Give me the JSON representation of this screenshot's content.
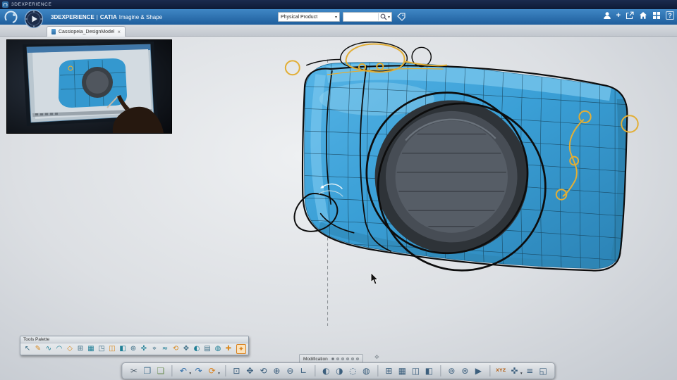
{
  "window_strip": {
    "brand": "3DEXPERIENCE"
  },
  "header": {
    "brand": "3DEXPERIENCE",
    "separator": "|",
    "app": "CATIA",
    "app_name": "Imagine & Shape",
    "context_value": "Physical Product",
    "context_caret": "▾",
    "search_placeholder": "",
    "search_caret": "▾",
    "add_label": "+",
    "help_label": "?",
    "icon_names": [
      "user-icon",
      "add-icon",
      "share-icon",
      "home-icon",
      "app-grid-icon",
      "help-icon",
      "search-icon",
      "tag-icon",
      "compass-icon",
      "3ds-logo"
    ]
  },
  "tab": {
    "label": "Cassiopeia_DesignModel",
    "close": "×"
  },
  "tools_palette": {
    "title": "Tools Palette",
    "icons": [
      {
        "name": "select",
        "glyph": "↖",
        "color": "#3c6e86"
      },
      {
        "name": "sketch-curve",
        "glyph": "✎",
        "color": "#d9891f"
      },
      {
        "name": "curve-wave",
        "glyph": "∿",
        "color": "#1f7f96"
      },
      {
        "name": "arc",
        "glyph": "◠",
        "color": "#1f7f96"
      },
      {
        "name": "face",
        "glyph": "◇",
        "color": "#d9891f"
      },
      {
        "name": "subdivide",
        "glyph": "⊞",
        "color": "#3c6e86"
      },
      {
        "name": "mesh",
        "glyph": "▦",
        "color": "#1f7f96"
      },
      {
        "name": "cut-face",
        "glyph": "◳",
        "color": "#3c6e86"
      },
      {
        "name": "extrude",
        "glyph": "◫",
        "color": "#d9891f"
      },
      {
        "name": "split",
        "glyph": "◧",
        "color": "#1f7f96"
      },
      {
        "name": "weld",
        "glyph": "⊕",
        "color": "#3c6e86"
      },
      {
        "name": "align",
        "glyph": "✜",
        "color": "#1f7f96"
      },
      {
        "name": "target-snap",
        "glyph": "⌖",
        "color": "#3c6e86"
      },
      {
        "name": "smooth",
        "glyph": "≈",
        "color": "#1f7f96"
      },
      {
        "name": "revolve",
        "glyph": "⟲",
        "color": "#d9891f"
      },
      {
        "name": "symmetry",
        "glyph": "✥",
        "color": "#3c6e86"
      },
      {
        "name": "shade-half",
        "glyph": "◐",
        "color": "#1f7f96"
      },
      {
        "name": "panel",
        "glyph": "▤",
        "color": "#3c6e86"
      },
      {
        "name": "sphere-mode",
        "glyph": "◍",
        "color": "#1f7f96"
      },
      {
        "name": "add-point",
        "glyph": "✚",
        "color": "#d9891f"
      },
      {
        "name": "modification-active",
        "glyph": "✦",
        "color": "#d9821f",
        "active": true
      }
    ]
  },
  "status": {
    "label": "Modification",
    "dot_count": 6,
    "active_dot": 0,
    "handle_glyph": "✥"
  },
  "dock": {
    "caret": "▾",
    "groups": [
      {
        "icons": [
          {
            "name": "cut",
            "glyph": "✂",
            "color": "#54626f"
          },
          {
            "name": "copy",
            "glyph": "❐",
            "color": "#44708f"
          },
          {
            "name": "paste",
            "glyph": "❏",
            "color": "#6d8f54"
          }
        ]
      },
      {
        "icons": [
          {
            "name": "undo",
            "glyph": "↶",
            "color": "#2f6da8",
            "caret": true
          },
          {
            "name": "redo",
            "glyph": "↷",
            "color": "#2f6da8"
          },
          {
            "name": "update",
            "glyph": "⟳",
            "color": "#d9821f",
            "caret": true
          }
        ]
      },
      {
        "icons": [
          {
            "name": "fit-all",
            "glyph": "⊡",
            "color": "#3c5f7d"
          },
          {
            "name": "pan",
            "glyph": "✥",
            "color": "#3c5f7d"
          },
          {
            "name": "rotate-view",
            "glyph": "⟲",
            "color": "#3c5f7d"
          },
          {
            "name": "zoom-in",
            "glyph": "⊕",
            "color": "#3c5f7d"
          },
          {
            "name": "zoom-out",
            "glyph": "⊖",
            "color": "#3c5f7d"
          },
          {
            "name": "normal-view",
            "glyph": "∟",
            "color": "#3c5f7d"
          }
        ]
      },
      {
        "icons": [
          {
            "name": "shading",
            "glyph": "◐",
            "color": "#3c5f7d"
          },
          {
            "name": "shading-edges",
            "glyph": "◑",
            "color": "#3c5f7d"
          },
          {
            "name": "wireframe",
            "glyph": "◌",
            "color": "#3c5f7d"
          },
          {
            "name": "hidden-line",
            "glyph": "◍",
            "color": "#3c5f7d"
          }
        ]
      },
      {
        "icons": [
          {
            "name": "grid",
            "glyph": "⊞",
            "color": "#3c5f7d"
          },
          {
            "name": "snap",
            "glyph": "▦",
            "color": "#3c5f7d"
          },
          {
            "name": "work-plane",
            "glyph": "◫",
            "color": "#3c5f7d"
          },
          {
            "name": "section",
            "glyph": "◧",
            "color": "#3c5f7d"
          }
        ]
      },
      {
        "icons": [
          {
            "name": "globe",
            "glyph": "⊚",
            "color": "#3c5f7d"
          },
          {
            "name": "share-view",
            "glyph": "⊛",
            "color": "#3c5f7d"
          },
          {
            "name": "play",
            "glyph": "▶",
            "color": "#3c5f7d"
          }
        ]
      },
      {
        "icons": [
          {
            "name": "axis-system",
            "glyph": "XYZ",
            "color": "#b5651d",
            "small_text": true
          },
          {
            "name": "compass-tool",
            "glyph": "✜",
            "color": "#3c5f7d",
            "caret": true
          },
          {
            "name": "settings-list",
            "glyph": "≡",
            "color": "#3c5f7d"
          },
          {
            "name": "corner-resize",
            "glyph": "◱",
            "color": "#3c5f7d"
          }
        ]
      }
    ]
  },
  "canvas": {
    "model_color": "#3a9fd6",
    "cage_color": "#111111",
    "guide_color": "#e2ae35"
  }
}
